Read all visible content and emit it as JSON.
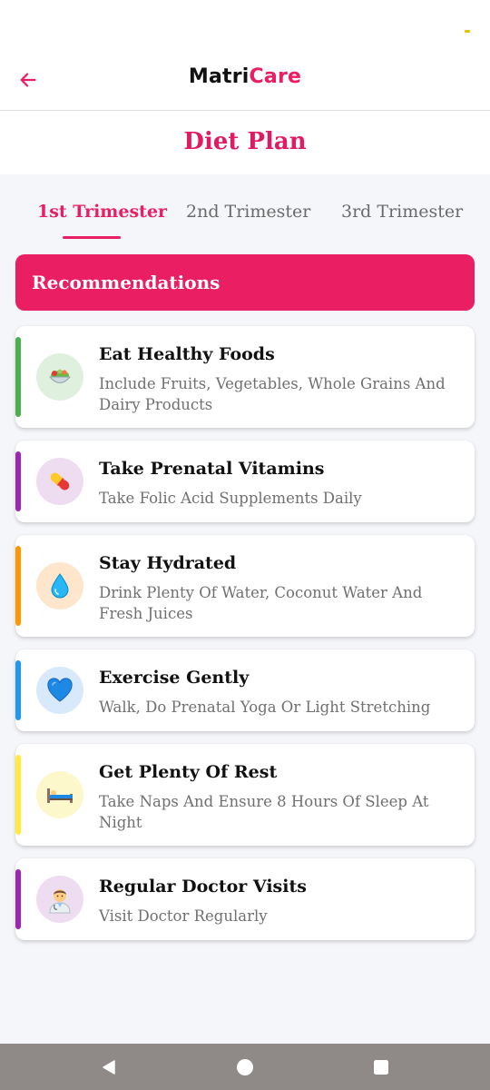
{
  "app": {
    "title_prefix": "Matri",
    "title_accent": "Care",
    "accent_color": "#e91e63"
  },
  "header": {
    "back_icon": "arrow-left-icon"
  },
  "page": {
    "title": "Diet Plan"
  },
  "tabs": [
    {
      "label": "1st Trimester",
      "active": true
    },
    {
      "label": "2nd Trimester",
      "active": false
    },
    {
      "label": "3rd Trimester",
      "active": false
    }
  ],
  "recommendations": {
    "label": "Recommendations",
    "color": "#ea1e63"
  },
  "cards": [
    {
      "title": "Eat Healthy Foods",
      "desc": "Include Fruits, Vegetables, Whole Grains And Dairy Products",
      "icon": "salad-icon",
      "accent": "#4caf50",
      "icon_bg": "#dff0df"
    },
    {
      "title": "Take Prenatal Vitamins",
      "desc": "Take Folic Acid Supplements Daily",
      "icon": "pill-icon",
      "accent": "#9c27b0",
      "icon_bg": "#eedcf1"
    },
    {
      "title": "Stay Hydrated",
      "desc": "Drink Plenty Of Water, Coconut Water And Fresh Juices",
      "icon": "water-drop-icon",
      "accent": "#ff9800",
      "icon_bg": "#fde6cc"
    },
    {
      "title": "Exercise Gently",
      "desc": "Walk, Do Prenatal Yoga Or Light Stretching",
      "icon": "blue-heart-icon",
      "accent": "#2196f3",
      "icon_bg": "#d7e9fb"
    },
    {
      "title": "Get Plenty Of Rest",
      "desc": "Take Naps And Ensure 8 Hours Of Sleep At Night",
      "icon": "bed-icon",
      "accent": "#ffeb3b",
      "icon_bg": "#fdf7cc"
    },
    {
      "title": "Regular Doctor Visits",
      "desc": "Visit Doctor Regularly",
      "icon": "doctor-icon",
      "accent": "#9c27b0",
      "icon_bg": "#eedcf1"
    }
  ],
  "system_nav": {
    "buttons": [
      "back-triangle-icon",
      "home-circle-icon",
      "recents-square-icon"
    ]
  }
}
